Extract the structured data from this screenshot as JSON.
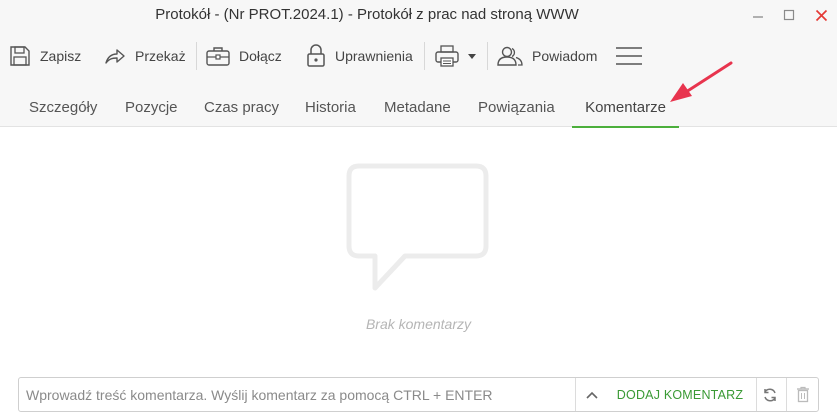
{
  "window": {
    "title": "Protokół - (Nr PROT.2024.1) - Protokół z prac nad stroną WWW",
    "controls": [
      "minimize-icon",
      "maximize-icon",
      "close-icon"
    ],
    "close_color": "#e53935"
  },
  "toolbar": {
    "save_label": "Zapisz",
    "forward_label": "Przekaż",
    "attach_label": "Dołącz",
    "permissions_label": "Uprawnienia",
    "notify_label": "Powiadom",
    "icons": [
      "floppy-disk-icon",
      "share-arrow-icon",
      "briefcase-icon",
      "padlock-icon",
      "printer-icon",
      "chevron-down-icon",
      "people-icon",
      "hamburger-menu-icon"
    ]
  },
  "tabs": [
    {
      "label": "Szczegóły",
      "active": false
    },
    {
      "label": "Pozycje",
      "active": false
    },
    {
      "label": "Czas pracy",
      "active": false
    },
    {
      "label": "Historia",
      "active": false
    },
    {
      "label": "Metadane",
      "active": false
    },
    {
      "label": "Powiązania",
      "active": false
    },
    {
      "label": "Komentarze",
      "active": true
    }
  ],
  "content": {
    "empty_icon": "speech-bubble-icon",
    "empty_text": "Brak komentarzy"
  },
  "annotation": {
    "arrow_color": "#e8344e"
  },
  "comment_bar": {
    "placeholder": "Wprowadź treść komentarza. Wyślij komentarz za pomocą CTRL + ENTER",
    "value": "",
    "add_label": "DODAJ KOMENTARZ",
    "icons": [
      "chevron-up-icon",
      "refresh-icon",
      "trash-icon"
    ]
  },
  "colors": {
    "accent_green": "#4caf3c",
    "toolbar_bg": "#f7f7f7"
  }
}
